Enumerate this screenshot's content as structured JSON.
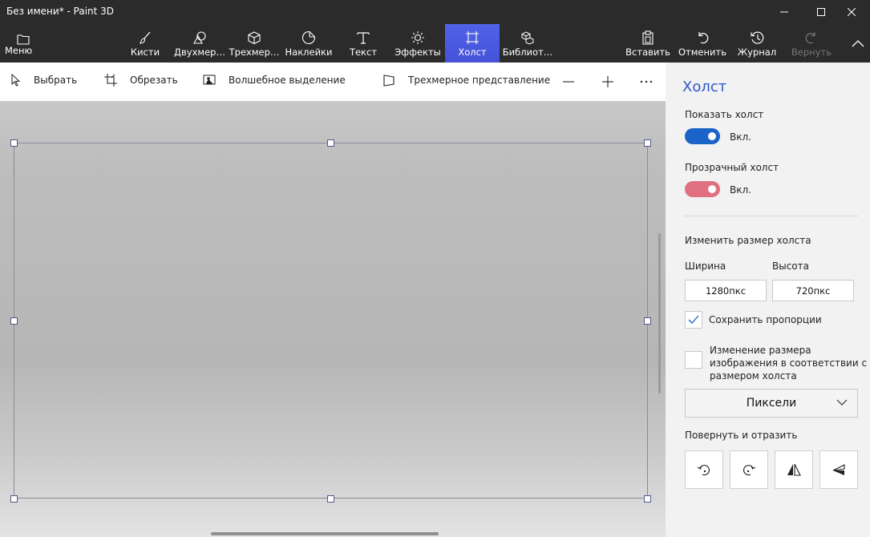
{
  "window": {
    "title": "Без имени* - Paint 3D"
  },
  "ribbon": {
    "menu_label": "Меню",
    "tabs": [
      {
        "label": "Кисти",
        "icon": "brush-icon"
      },
      {
        "label": "Двухмер…",
        "icon": "2d-shapes-icon"
      },
      {
        "label": "Трехмер…",
        "icon": "3d-shapes-icon"
      },
      {
        "label": "Наклейки",
        "icon": "stickers-icon"
      },
      {
        "label": "Текст",
        "icon": "text-icon"
      },
      {
        "label": "Эффекты",
        "icon": "effects-icon"
      },
      {
        "label": "Холст",
        "icon": "canvas-icon"
      },
      {
        "label": "Библиот…",
        "icon": "library-icon"
      }
    ],
    "actions": {
      "paste": "Вставить",
      "undo": "Отменить",
      "history": "Журнал",
      "redo": "Вернуть"
    },
    "active_color": "#4f5fe6"
  },
  "toolbar": {
    "select": "Выбрать",
    "crop": "Обрезать",
    "magic_select": "Волшебное выделение",
    "view_3d": "Трехмерное представление"
  },
  "panel": {
    "title": "Холст",
    "show_canvas": {
      "label": "Показать холст",
      "state": "Вкл.",
      "color": "#1a63c9"
    },
    "transparent_canvas": {
      "label": "Прозрачный холст",
      "state": "Вкл.",
      "color": "#e0707f"
    },
    "resize_title": "Изменить размер холста",
    "width_label": "Ширина",
    "height_label": "Высота",
    "width_value": "1280пкс",
    "height_value": "720пкс",
    "keep_ratio": {
      "label": "Сохранить пропорции",
      "checked": true
    },
    "resize_image": {
      "line1": "Изменение размера",
      "line2": "изображения в соответствии с",
      "line3": "размером холста",
      "checked": false
    },
    "units": "Пиксели",
    "rotate_title": "Повернуть и отразить"
  }
}
